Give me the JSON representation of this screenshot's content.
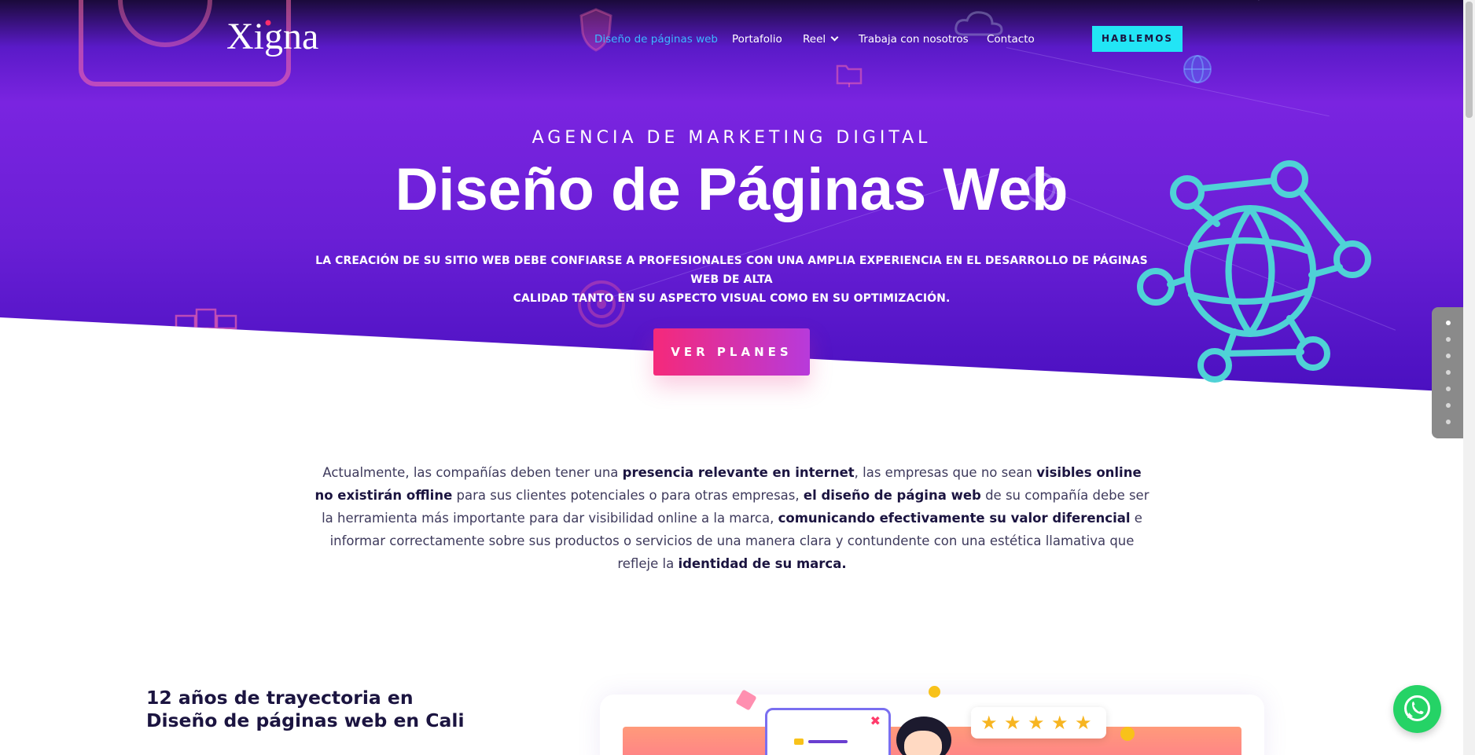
{
  "header": {
    "logo_text": "Xigna",
    "nav": [
      {
        "label": "Diseño de páginas web",
        "active": true
      },
      {
        "label": "Portafolio"
      },
      {
        "label": "Reel",
        "has_dropdown": true
      },
      {
        "label": "Trabaja con nosotros"
      },
      {
        "label": "Contacto"
      }
    ],
    "cta_label": "HABLEMOS"
  },
  "hero": {
    "eyebrow": "AGENCIA DE MARKETING DIGITAL",
    "title": "Diseño de Páginas Web",
    "subtitle_line1": "LA CREACIÓN DE SU SITIO WEB DEBE CONFIARSE A PROFESIONALES CON UNA AMPLIA EXPERIENCIA EN EL DESARROLLO DE PÁGINAS WEB DE ALTA",
    "subtitle_line2": "CALIDAD TANTO EN SU ASPECTO VISUAL COMO EN SU OPTIMIZACIÓN.",
    "button_label": "VER PLANES"
  },
  "intro": {
    "p1": "Actualmente, las compañías deben tener una ",
    "b1": "presencia relevante en internet",
    "p2": ", las empresas que no sean ",
    "b2": "visibles online no existirán offline",
    "p3": " para sus clientes potenciales o para otras empresas, ",
    "b3": "el diseño de página web",
    "p4": " de su compañía debe ser la herramienta más importante para dar visibilidad online a la marca, ",
    "b4": "comunicando efectivamente su valor diferencial",
    "p5": " e informar correctamente sobre sus productos o servicios de una manera clara y contundente con una estética llamativa que refleje la ",
    "b5": "identidad de su marca."
  },
  "section": {
    "title_line1": "12 años de trayectoria en",
    "title_line2": "Diseño de páginas web en Cali"
  },
  "illustration": {
    "stars": [
      "★",
      "★",
      "★",
      "★",
      "★"
    ],
    "close_glyph": "✖"
  },
  "scroll_dots": {
    "count": 7,
    "active_index": 0
  },
  "colors": {
    "hero_purple": "#7a24e0",
    "accent_cyan": "#22e5f5",
    "button_pink": "#f5297a",
    "nav_active": "#3db8ff",
    "heading_dark": "#1b1440",
    "whatsapp_green": "#25d366"
  },
  "icons": {
    "whatsapp": "whatsapp-icon",
    "globe": "network-globe-icon",
    "dropdown": "chevron-down-icon"
  }
}
